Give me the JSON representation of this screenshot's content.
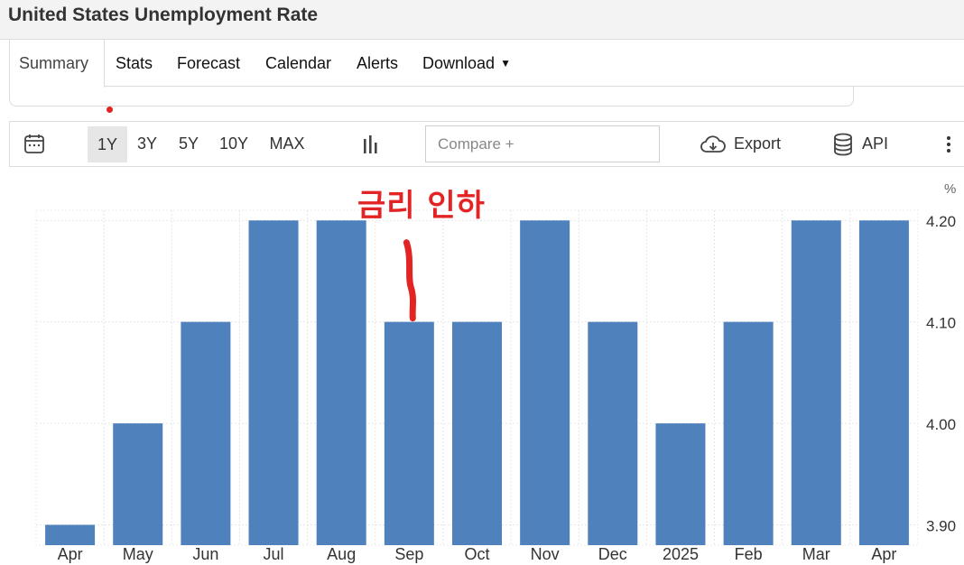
{
  "header": {
    "title": "United States Unemployment Rate"
  },
  "tabs": [
    {
      "label": "Summary",
      "active": true
    },
    {
      "label": "Stats"
    },
    {
      "label": "Forecast"
    },
    {
      "label": "Calendar"
    },
    {
      "label": "Alerts"
    },
    {
      "label": "Download",
      "dropdown": true
    }
  ],
  "toolbar": {
    "calendar_icon": "calendar-icon",
    "ranges": [
      "1Y",
      "3Y",
      "5Y",
      "10Y",
      "MAX"
    ],
    "active_range": "1Y",
    "chart_type_icon": "bar-chart-icon",
    "compare_placeholder": "Compare +",
    "export_label": "Export",
    "export_icon": "cloud-download-icon",
    "api_label": "API",
    "api_icon": "database-icon",
    "more_icon": "more-vertical-icon"
  },
  "annotation": {
    "text": "금리 인하",
    "color": "#e32424",
    "target_category": "Sep"
  },
  "chart_data": {
    "type": "bar",
    "categories": [
      "Apr",
      "May",
      "Jun",
      "Jul",
      "Aug",
      "Sep",
      "Oct",
      "Nov",
      "Dec",
      "2025",
      "Feb",
      "Mar",
      "Apr"
    ],
    "values": [
      3.9,
      4.0,
      4.1,
      4.2,
      4.2,
      4.1,
      4.1,
      4.2,
      4.1,
      4.0,
      4.1,
      4.2,
      4.2
    ],
    "unit_label": "%",
    "yticks": [
      "4.20",
      "4.10",
      "4.00",
      "3.90"
    ],
    "ylim": [
      3.88,
      4.21
    ],
    "bar_color": "#4f81bd",
    "grid": true
  }
}
